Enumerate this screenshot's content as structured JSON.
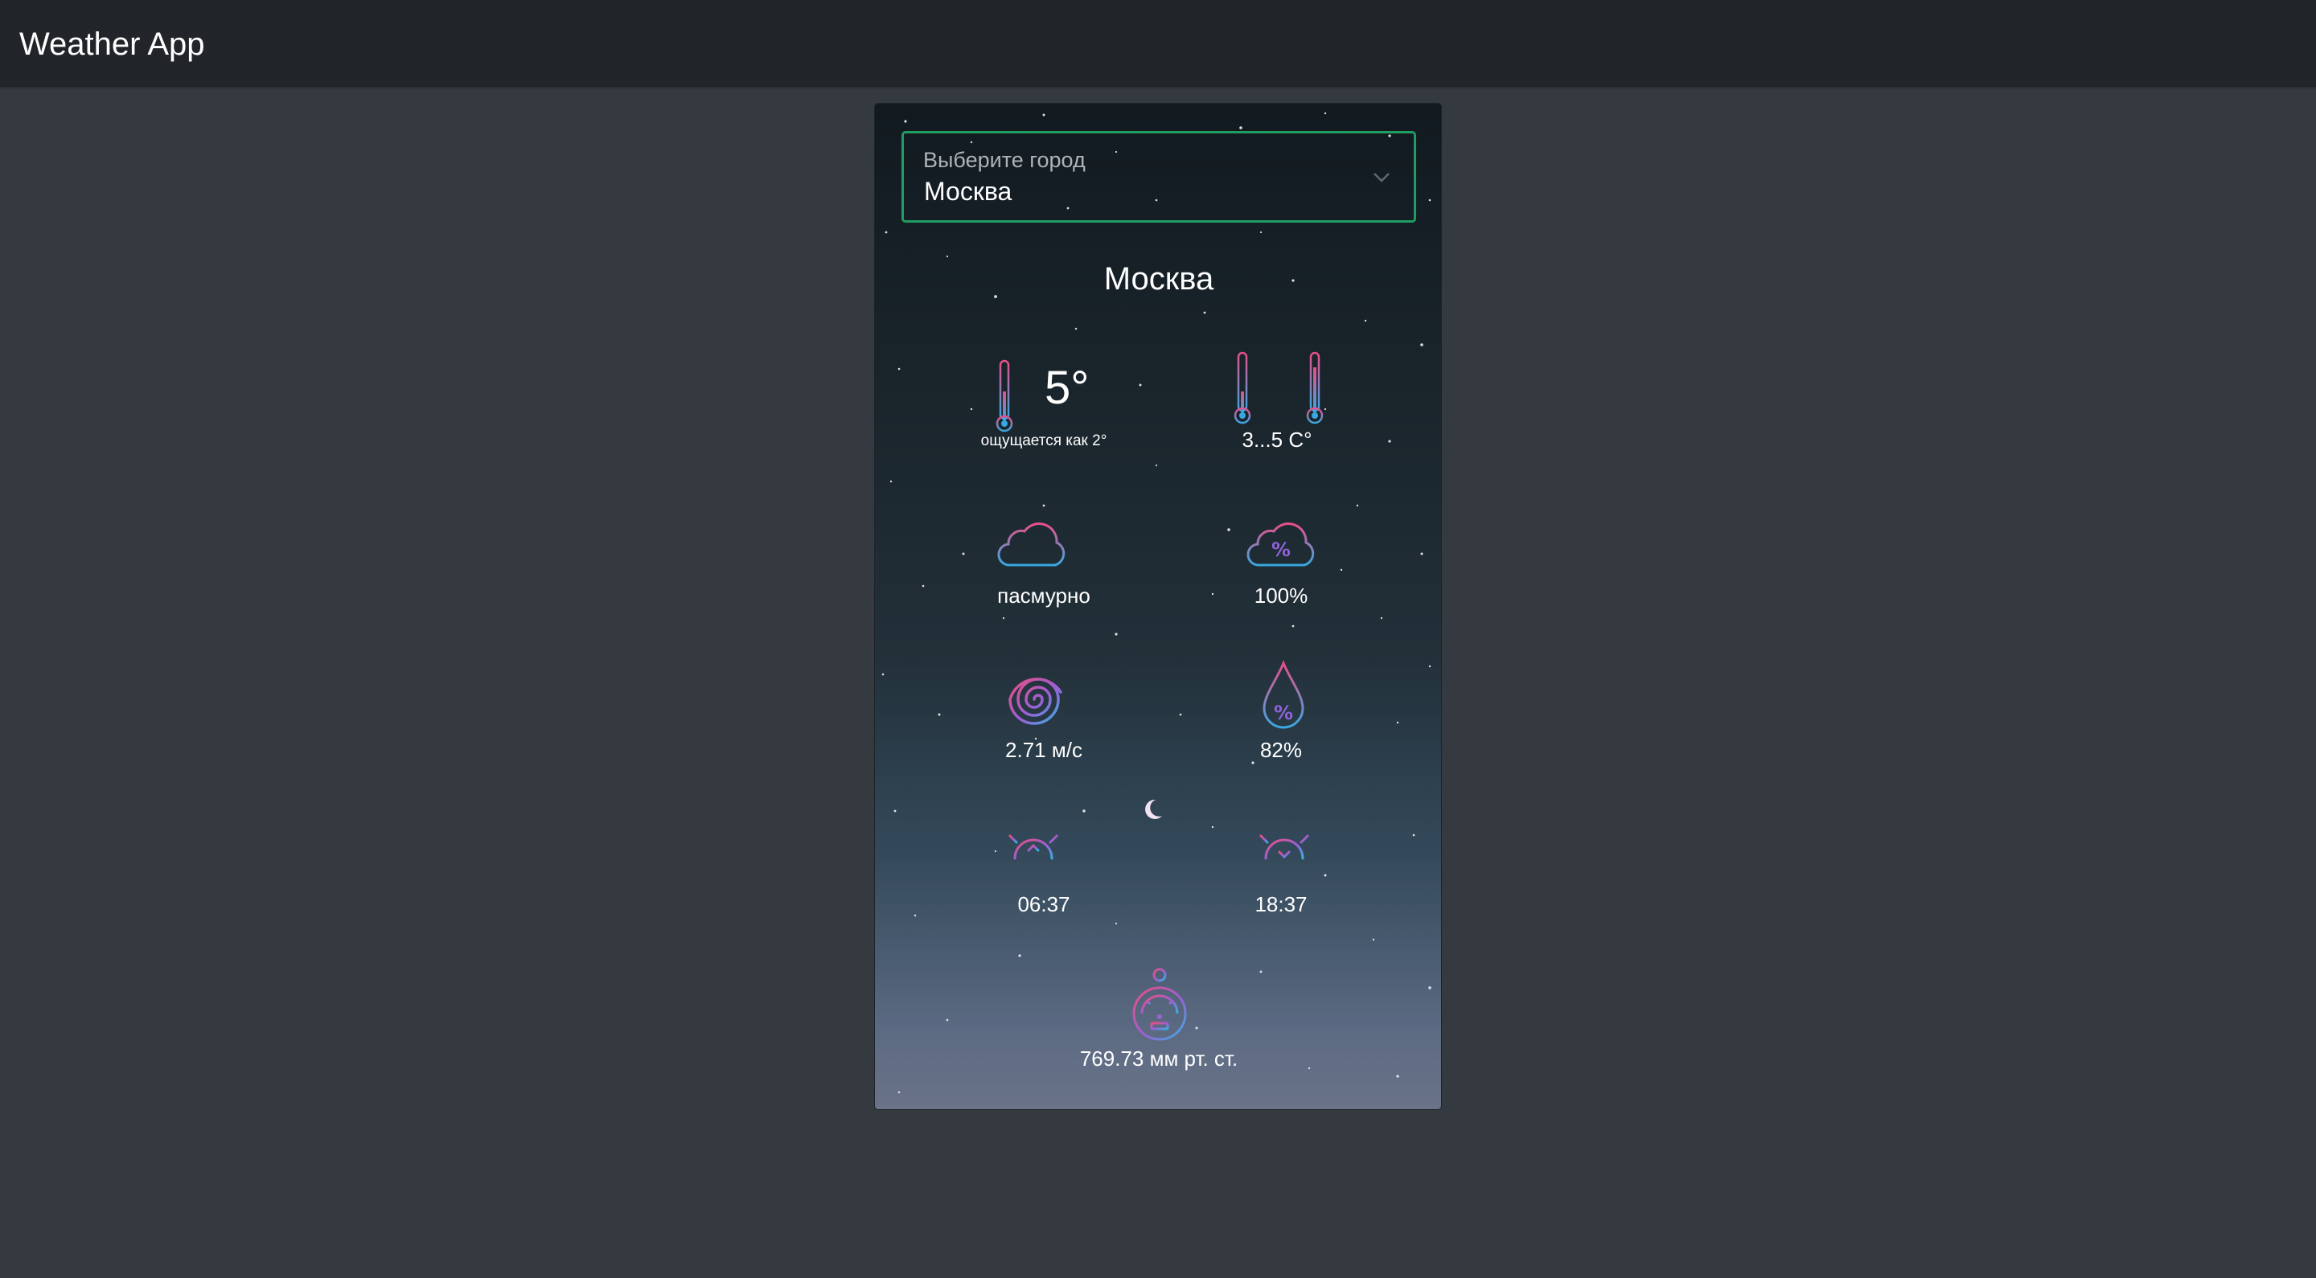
{
  "app": {
    "title": "Weather App"
  },
  "city_select": {
    "label": "Выберите город",
    "selected": "Москва"
  },
  "weather": {
    "city": "Москва",
    "temperature": "5°",
    "feels_like": "ощущается как 2°",
    "range": "3...5 C°",
    "condition": "пасмурно",
    "cloudiness": "100%",
    "wind": "2.71 м/с",
    "humidity": "82%",
    "sunrise": "06:37",
    "sunset": "18:37",
    "pressure": "769.73 мм рт. ст."
  },
  "icons": {
    "temperature": "thermometer-icon",
    "range": "thermometers-icon",
    "condition": "cloud-icon",
    "cloudiness": "cloud-percent-icon",
    "wind": "wind-spiral-icon",
    "humidity": "drop-percent-icon",
    "sunrise": "sunrise-icon",
    "sunset": "sunset-icon",
    "pressure": "barometer-icon",
    "moon": "moon-icon"
  },
  "colors": {
    "navbar": "#212529",
    "page_bg": "#343a40",
    "select_border": "#1f9d62",
    "icon_gradient_start": "#e84f8a",
    "icon_gradient_end": "#3aa7e0"
  }
}
